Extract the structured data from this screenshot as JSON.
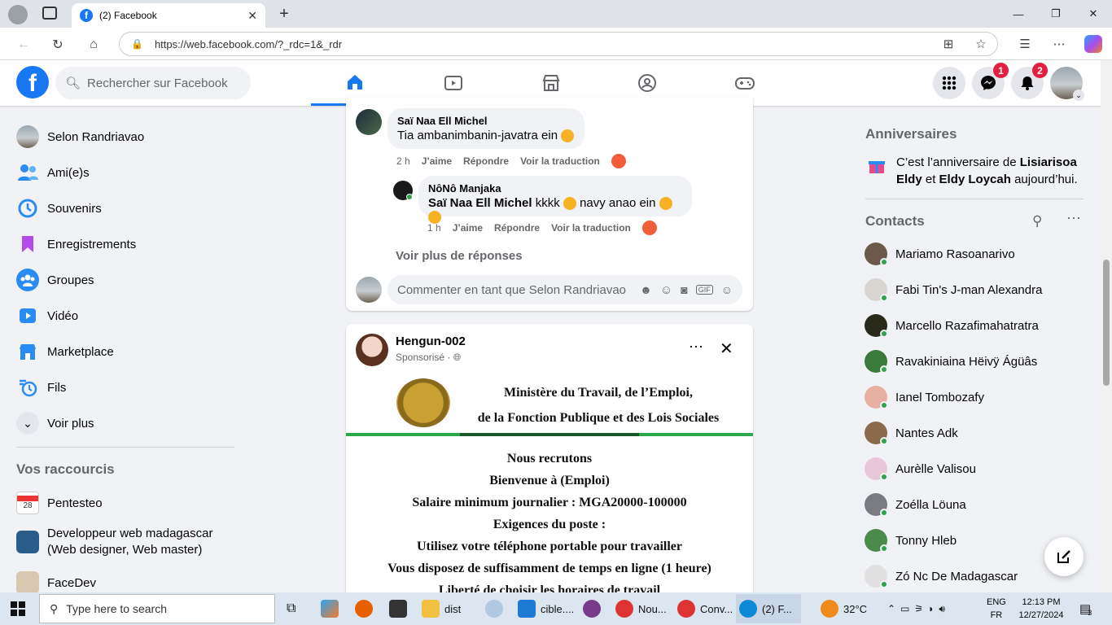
{
  "browser": {
    "tab_title": "(2) Facebook",
    "url": "https://web.facebook.com/?_rdc=1&_rdr"
  },
  "fb": {
    "search_placeholder": "Rechercher sur Facebook",
    "messenger_badge": "1",
    "notif_badge": "2"
  },
  "left": {
    "items": [
      {
        "label": "Selon Randriavao",
        "icon": "profile-avatar"
      },
      {
        "label": "Ami(e)s",
        "icon": "friends-icon"
      },
      {
        "label": "Souvenirs",
        "icon": "memories-icon"
      },
      {
        "label": "Enregistrements",
        "icon": "bookmark-icon"
      },
      {
        "label": "Groupes",
        "icon": "groups-icon"
      },
      {
        "label": "Vidéo",
        "icon": "video-icon"
      },
      {
        "label": "Marketplace",
        "icon": "marketplace-icon"
      },
      {
        "label": "Fils",
        "icon": "feeds-icon"
      },
      {
        "label": "Voir plus",
        "icon": "chevron-down-icon"
      }
    ],
    "shortcuts_title": "Vos raccourcis",
    "shortcuts": [
      {
        "label": "Pentesteo"
      },
      {
        "label": "Developpeur web madagascar (Web designer, Web master)"
      },
      {
        "label": "FaceDev"
      }
    ]
  },
  "comments": {
    "c1": {
      "name": "Saï Naa Ell Michel",
      "text": "Tia ambanimbanin-javatra ein",
      "time": "2 h",
      "like": "J’aime",
      "reply": "Répondre",
      "translate": "Voir la traduction"
    },
    "c2": {
      "name": "NôNô Manjaka",
      "mention": "Saï Naa Ell Michel",
      "text": "kkkk",
      "text2": "navy anao ein",
      "time": "1 h",
      "like": "J’aime",
      "reply": "Répondre",
      "translate": "Voir la traduction"
    },
    "more_replies": "Voir plus de réponses",
    "input_placeholder": "Commenter en tant que Selon Randriavao"
  },
  "post": {
    "author": "Hengun-002",
    "sponsored": "Sponsorisé ·",
    "ad_header1": "Ministère du Travail, de l’Emploi,",
    "ad_header2": "de la Fonction Publique et des Lois Sociales",
    "ad_lines": [
      "Nous recrutons",
      "Bienvenue à (Emploi)",
      "Salaire minimum journalier : MGA20000-100000",
      "Exigences du poste :",
      "Utilisez votre téléphone portable pour travailler",
      "Vous disposez de suffisamment de temps en ligne (1 heure)",
      "Liberté de choisir les horaires de travail"
    ]
  },
  "right": {
    "birthdays_title": "Anniversaires",
    "birthday_pre": "C’est l’anniversaire de",
    "birthday_name1": "Lisiarisoa Eldy",
    "birthday_and": "et",
    "birthday_name2": "Eldy Loycah",
    "birthday_post": "aujourd’hui.",
    "contacts_title": "Contacts",
    "contacts": [
      "Mariamo Rasoanarivo",
      "Fabi Tin's J-man Alexandra",
      "Marcello Razafimahatratra",
      "Ravakiniaina Hëivÿ Ágüâs",
      "Ianel Tombozafy",
      "Nantes Adk",
      "Aurèlle Valisou",
      "Zoélla Löuna",
      "Tonny Hleb",
      "Zó Nc De Madagascar"
    ]
  },
  "taskbar": {
    "search": "Type here to search",
    "apps": [
      "dist",
      "cible....",
      "Nou...",
      "Conv...",
      "(2) F..."
    ],
    "temp": "32°C",
    "lang1": "ENG",
    "lang2": "FR",
    "time": "12:13 PM",
    "date": "12/27/2024",
    "notif_count": "3"
  }
}
